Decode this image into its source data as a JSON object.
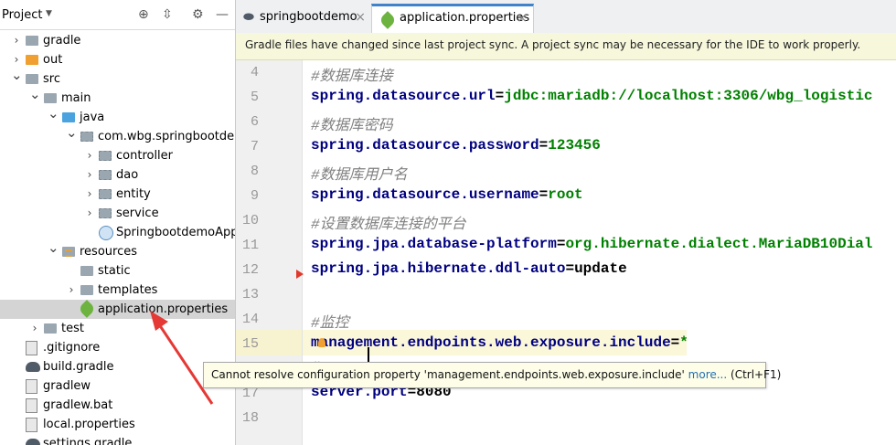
{
  "project_panel": {
    "title": "Project",
    "tree": [
      {
        "label": "gradle",
        "indent": 0,
        "arrow": "right",
        "icon": "folder-grey"
      },
      {
        "label": "out",
        "indent": 0,
        "arrow": "right",
        "icon": "folder-orange"
      },
      {
        "label": "src",
        "indent": 0,
        "arrow": "down",
        "icon": "folder-grey"
      },
      {
        "label": "main",
        "indent": 1,
        "arrow": "down",
        "icon": "folder-grey"
      },
      {
        "label": "java",
        "indent": 2,
        "arrow": "down",
        "icon": "folder-blue"
      },
      {
        "label": "com.wbg.springbootdemo",
        "indent": 3,
        "arrow": "down",
        "icon": "package"
      },
      {
        "label": "controller",
        "indent": 4,
        "arrow": "right",
        "icon": "package"
      },
      {
        "label": "dao",
        "indent": 4,
        "arrow": "right",
        "icon": "package"
      },
      {
        "label": "entity",
        "indent": 4,
        "arrow": "right",
        "icon": "package"
      },
      {
        "label": "service",
        "indent": 4,
        "arrow": "right",
        "icon": "package"
      },
      {
        "label": "SpringbootdemoApplicat",
        "indent": 4,
        "arrow": "none",
        "icon": "class"
      },
      {
        "label": "resources",
        "indent": 2,
        "arrow": "down",
        "icon": "resources"
      },
      {
        "label": "static",
        "indent": 3,
        "arrow": "none",
        "icon": "folder-grey"
      },
      {
        "label": "templates",
        "indent": 3,
        "arrow": "right",
        "icon": "folder-grey"
      },
      {
        "label": "application.properties",
        "indent": 3,
        "arrow": "none",
        "icon": "spring-leaf",
        "selected": true
      },
      {
        "label": "test",
        "indent": 1,
        "arrow": "right",
        "icon": "folder-grey"
      },
      {
        "label": ".gitignore",
        "indent": 0,
        "arrow": "none",
        "icon": "file"
      },
      {
        "label": "build.gradle",
        "indent": 0,
        "arrow": "none",
        "icon": "gradle"
      },
      {
        "label": "gradlew",
        "indent": 0,
        "arrow": "none",
        "icon": "file"
      },
      {
        "label": "gradlew.bat",
        "indent": 0,
        "arrow": "none",
        "icon": "file"
      },
      {
        "label": "local.properties",
        "indent": 0,
        "arrow": "none",
        "icon": "file"
      },
      {
        "label": "settings.gradle",
        "indent": 0,
        "arrow": "none",
        "icon": "gradle"
      }
    ]
  },
  "tabs": [
    {
      "label": "springbootdemo",
      "active": false
    },
    {
      "label": "application.properties",
      "active": true
    }
  ],
  "notification": "Gradle files have changed since last project sync. A project sync may be necessary for the IDE to work properly.",
  "editor": {
    "lines": [
      {
        "num": "4",
        "parts": [
          {
            "t": "#数据库连接",
            "c": "comment"
          }
        ]
      },
      {
        "num": "5",
        "parts": [
          {
            "t": "spring.datasource.url",
            "c": "key"
          },
          {
            "t": "=",
            "c": "plain"
          },
          {
            "t": "jdbc:mariadb://localhost:3306/wbg_logistic",
            "c": "val"
          }
        ]
      },
      {
        "num": "6",
        "parts": [
          {
            "t": "#数据库密码",
            "c": "comment"
          }
        ]
      },
      {
        "num": "7",
        "parts": [
          {
            "t": "spring.datasource.password",
            "c": "key"
          },
          {
            "t": "=",
            "c": "plain"
          },
          {
            "t": "123456",
            "c": "val"
          }
        ]
      },
      {
        "num": "8",
        "parts": [
          {
            "t": "#数据库用户名",
            "c": "comment"
          }
        ]
      },
      {
        "num": "9",
        "parts": [
          {
            "t": "spring.datasource.username",
            "c": "key"
          },
          {
            "t": "=",
            "c": "plain"
          },
          {
            "t": "root",
            "c": "val"
          }
        ]
      },
      {
        "num": "10",
        "parts": [
          {
            "t": "#设置数据库连接的平台",
            "c": "comment"
          }
        ]
      },
      {
        "num": "11",
        "parts": [
          {
            "t": "spring.jpa.database-platform",
            "c": "key"
          },
          {
            "t": "=",
            "c": "plain"
          },
          {
            "t": "org.hibernate.dialect.MariaDB10Dial",
            "c": "val"
          }
        ]
      },
      {
        "num": "12",
        "parts": [
          {
            "t": "spring.jpa.hibernate.ddl-auto",
            "c": "key"
          },
          {
            "t": "=",
            "c": "plain"
          },
          {
            "t": "update",
            "c": "plain"
          }
        ]
      },
      {
        "num": "13",
        "parts": []
      },
      {
        "num": "14",
        "parts": [
          {
            "t": "#监控",
            "c": "comment"
          }
        ]
      },
      {
        "num": "15",
        "parts": [
          {
            "t": "management.endpoints.web.exposure.include",
            "c": "key"
          },
          {
            "t": "=",
            "c": "plain"
          },
          {
            "t": "*",
            "c": "val"
          }
        ]
      },
      {
        "num": "16",
        "parts": [
          {
            "t": "#",
            "c": "comment"
          }
        ]
      },
      {
        "num": "17",
        "parts": [
          {
            "t": "server.port",
            "c": "key"
          },
          {
            "t": "=",
            "c": "plain"
          },
          {
            "t": "8080",
            "c": "plain"
          }
        ]
      },
      {
        "num": "18",
        "parts": []
      }
    ]
  },
  "tooltip": {
    "message": "Cannot resolve configuration property 'management.endpoints.web.exposure.include'",
    "more": "more...",
    "shortcut": "(Ctrl+F1)"
  },
  "colors": {
    "accent": "#4083c9",
    "annotation_arrow": "#e53935"
  }
}
